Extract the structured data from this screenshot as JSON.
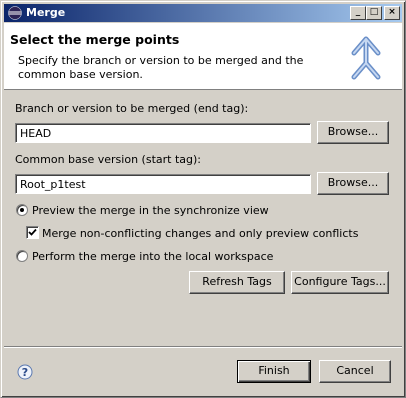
{
  "window": {
    "title": "Merge"
  },
  "banner": {
    "title": "Select the merge points",
    "description": "Specify the branch or version to be merged and the common base version."
  },
  "end_tag": {
    "label": "Branch or version to be merged (end tag):",
    "value": "HEAD",
    "browse_label": "Browse..."
  },
  "start_tag": {
    "label": "Common base version (start tag):",
    "value": "Root_p1test",
    "browse_label": "Browse..."
  },
  "options": {
    "preview": {
      "label": "Preview the merge in the synchronize view",
      "selected": true
    },
    "merge_nonconflicting": {
      "label": "Merge non-conflicting changes and only preview conflicts",
      "checked": true
    },
    "perform": {
      "label": "Perform the merge into the local workspace",
      "selected": false
    }
  },
  "buttons": {
    "refresh_tags": "Refresh Tags",
    "configure_tags": "Configure Tags...",
    "finish": "Finish",
    "cancel": "Cancel"
  },
  "icons": {
    "app": "eclipse-icon",
    "banner": "merge-arrows-icon",
    "help": "help-icon"
  }
}
